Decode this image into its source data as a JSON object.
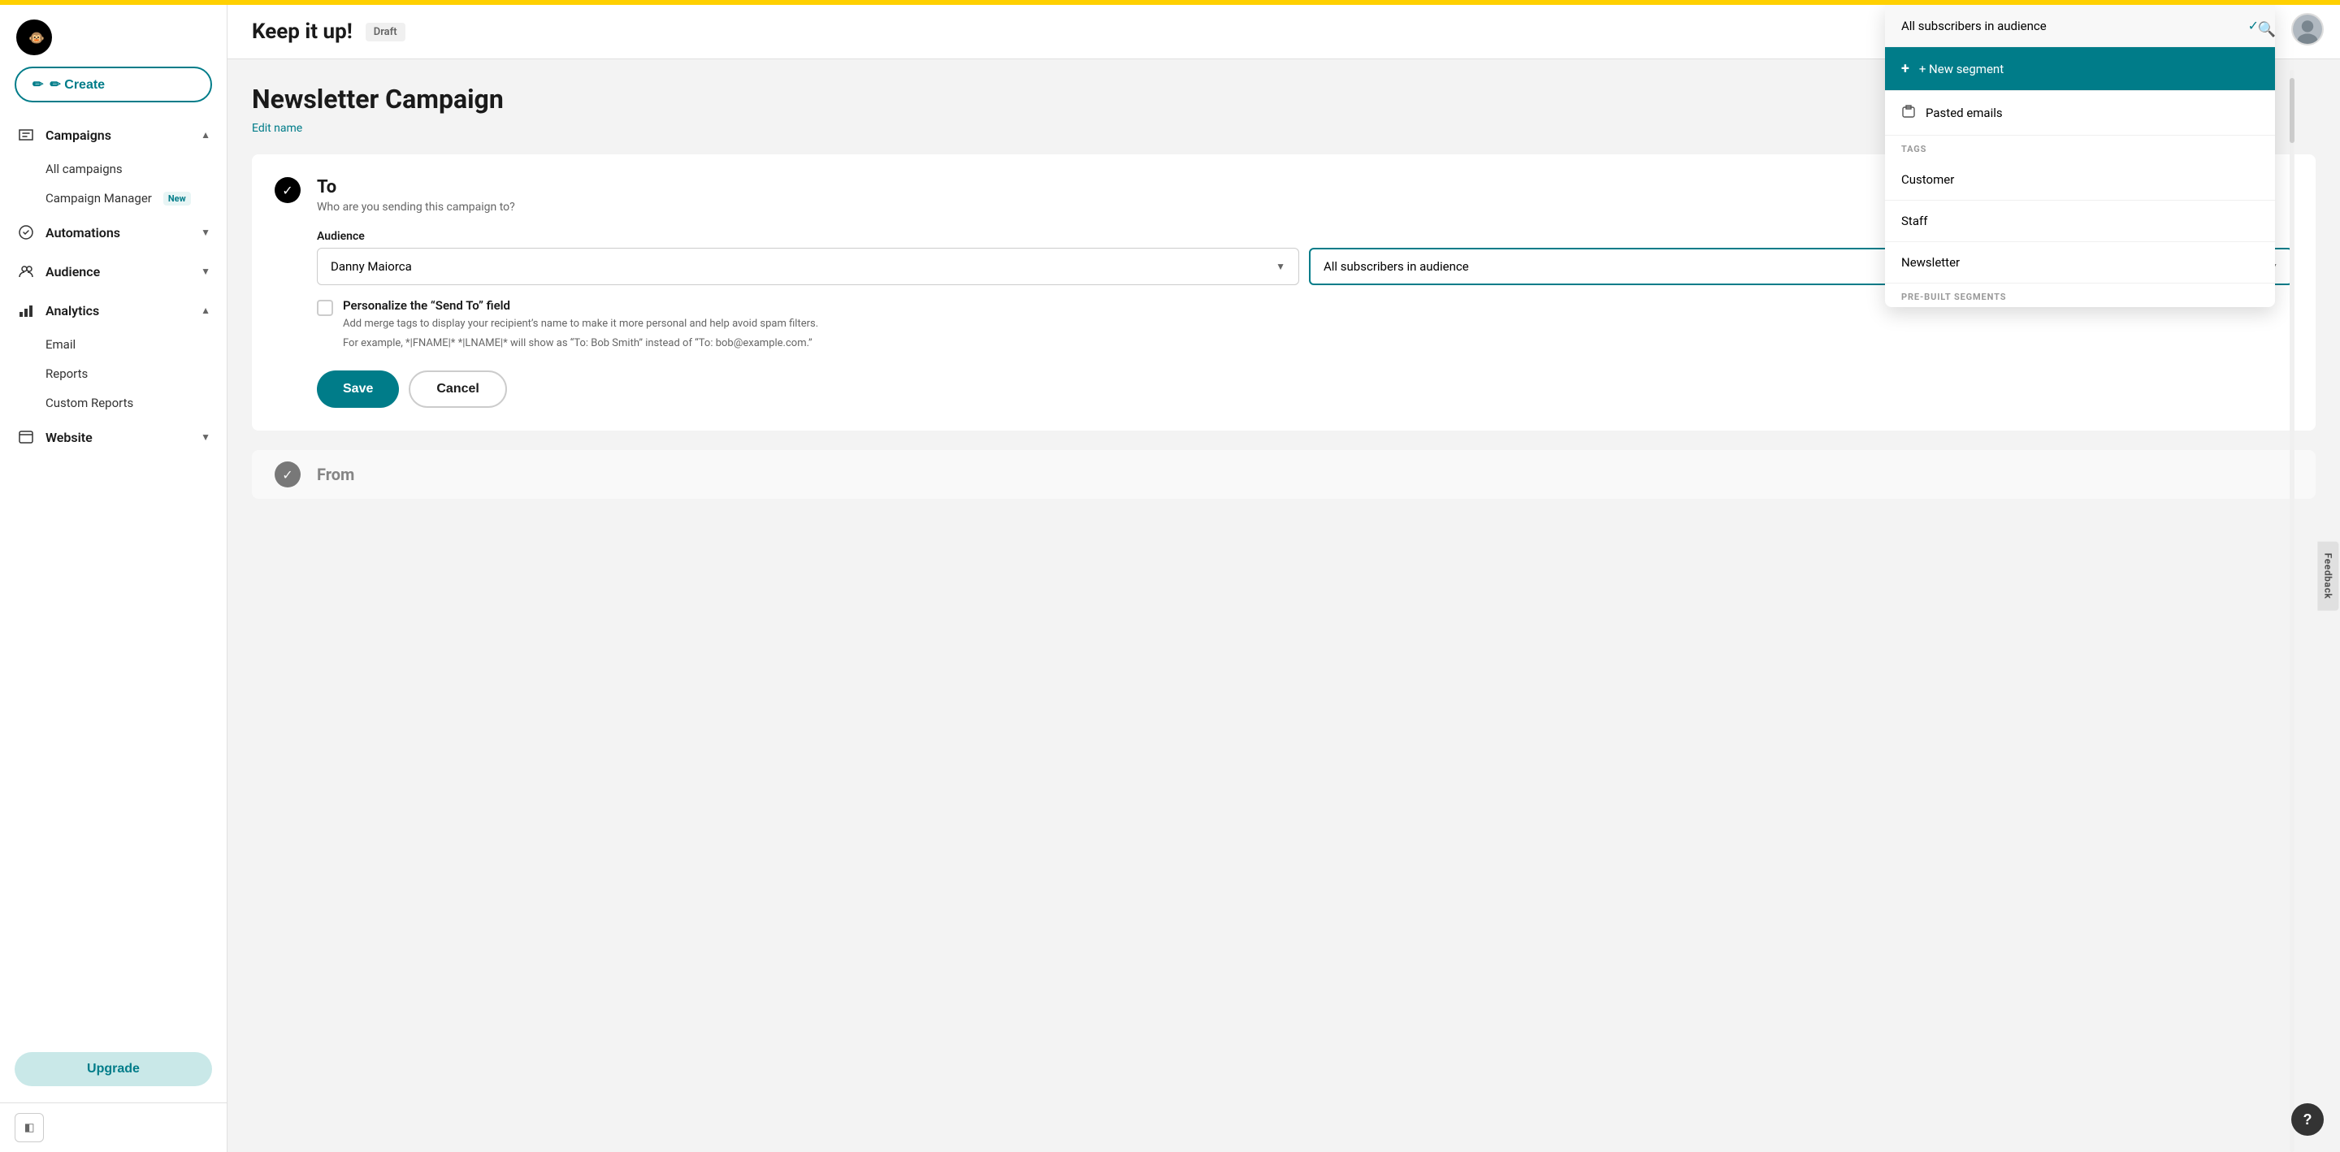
{
  "topBar": {},
  "sidebar": {
    "logo": "🐵",
    "createLabel": "✏ Create",
    "nav": [
      {
        "id": "campaigns",
        "label": "Campaigns",
        "icon": "📣",
        "expanded": true,
        "subItems": [
          {
            "label": "All campaigns",
            "badge": null
          },
          {
            "label": "Campaign Manager",
            "badge": "New"
          }
        ]
      },
      {
        "id": "automations",
        "label": "Automations",
        "icon": "⚙️",
        "expanded": false,
        "subItems": []
      },
      {
        "id": "audience",
        "label": "Audience",
        "icon": "👥",
        "expanded": false,
        "subItems": []
      },
      {
        "id": "analytics",
        "label": "Analytics",
        "icon": "📊",
        "expanded": true,
        "subItems": [
          {
            "label": "Email",
            "badge": null
          },
          {
            "label": "Reports",
            "badge": null
          },
          {
            "label": "Custom Reports",
            "badge": null
          }
        ]
      },
      {
        "id": "website",
        "label": "Website",
        "icon": "🌐",
        "expanded": false,
        "subItems": []
      }
    ],
    "upgradeLabel": "Upgrade"
  },
  "header": {
    "title": "Keep it up!",
    "draftBadge": "Draft"
  },
  "campaign": {
    "title": "Newsletter Campaign",
    "editNameLabel": "Edit name",
    "section": {
      "icon": "✓",
      "label": "To",
      "description": "Who are you sending this campaign to?",
      "audienceFieldLabel": "Audience",
      "audienceValue": "Danny Maiorca",
      "segmentValue": "All subscribers in audience",
      "checkboxLabel": "Personalize the “Send To” field",
      "checkboxSubText1": "Add merge tags to display your recipient’s name to make it more personal and help avoid spam filters.",
      "checkboxSubText2": "For example, *|FNAME|* *|LNAME|* will show as “To: Bob Smith” instead of “To: bob@example.com.”",
      "saveLabel": "Save",
      "cancelLabel": "Cancel"
    }
  },
  "dropdown": {
    "items": [
      {
        "label": "All subscribers in audience",
        "type": "option",
        "selected": true
      },
      {
        "label": "+ New segment",
        "type": "action",
        "highlighted": true
      },
      {
        "label": "Pasted emails",
        "type": "option",
        "highlighted": false
      }
    ],
    "sections": [
      {
        "label": "TAGS",
        "items": [
          {
            "label": "Customer"
          },
          {
            "label": "Staff"
          },
          {
            "label": "Newsletter"
          }
        ]
      },
      {
        "label": "PRE-BUILT SEGMENTS",
        "items": []
      }
    ]
  },
  "feedback": {
    "label": "Feedback"
  },
  "help": {
    "label": "?"
  }
}
